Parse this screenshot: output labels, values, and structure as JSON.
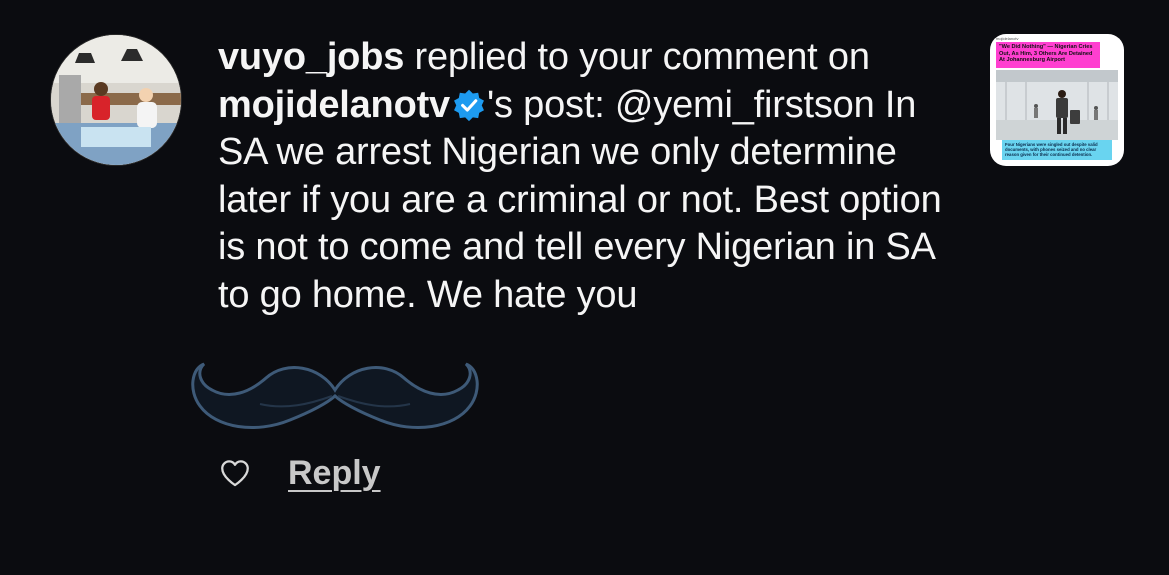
{
  "notification": {
    "username": "vuyo_jobs",
    "action_text": " replied to your comment on ",
    "post_owner": "mojidelanotv",
    "post_suffix": "'s post:",
    "reply_text": " @yemi_firstson In SA we arrest Nigerian we only determine later if you are a criminal or not. Best option is not to come and tell every Nigerian in SA to go home. We hate you",
    "verified_icon": "verified-badge-icon",
    "accent_color": "#1d9bf0"
  },
  "thumbnail": {
    "brand": "mojidelanotv",
    "headline": "\"We Did Nothing\" — Nigerian Cries Out, As Him, 3 Others Are Detained At Johannesburg Airport",
    "caption": "Four Nigerians were singled out despite valid documents, with phones seized and no clear reason given for their continued detention."
  },
  "actions": {
    "like_icon": "heart-outline-icon",
    "reply_label": "Reply"
  },
  "overlay": {
    "icon": "mustache-sticker"
  }
}
